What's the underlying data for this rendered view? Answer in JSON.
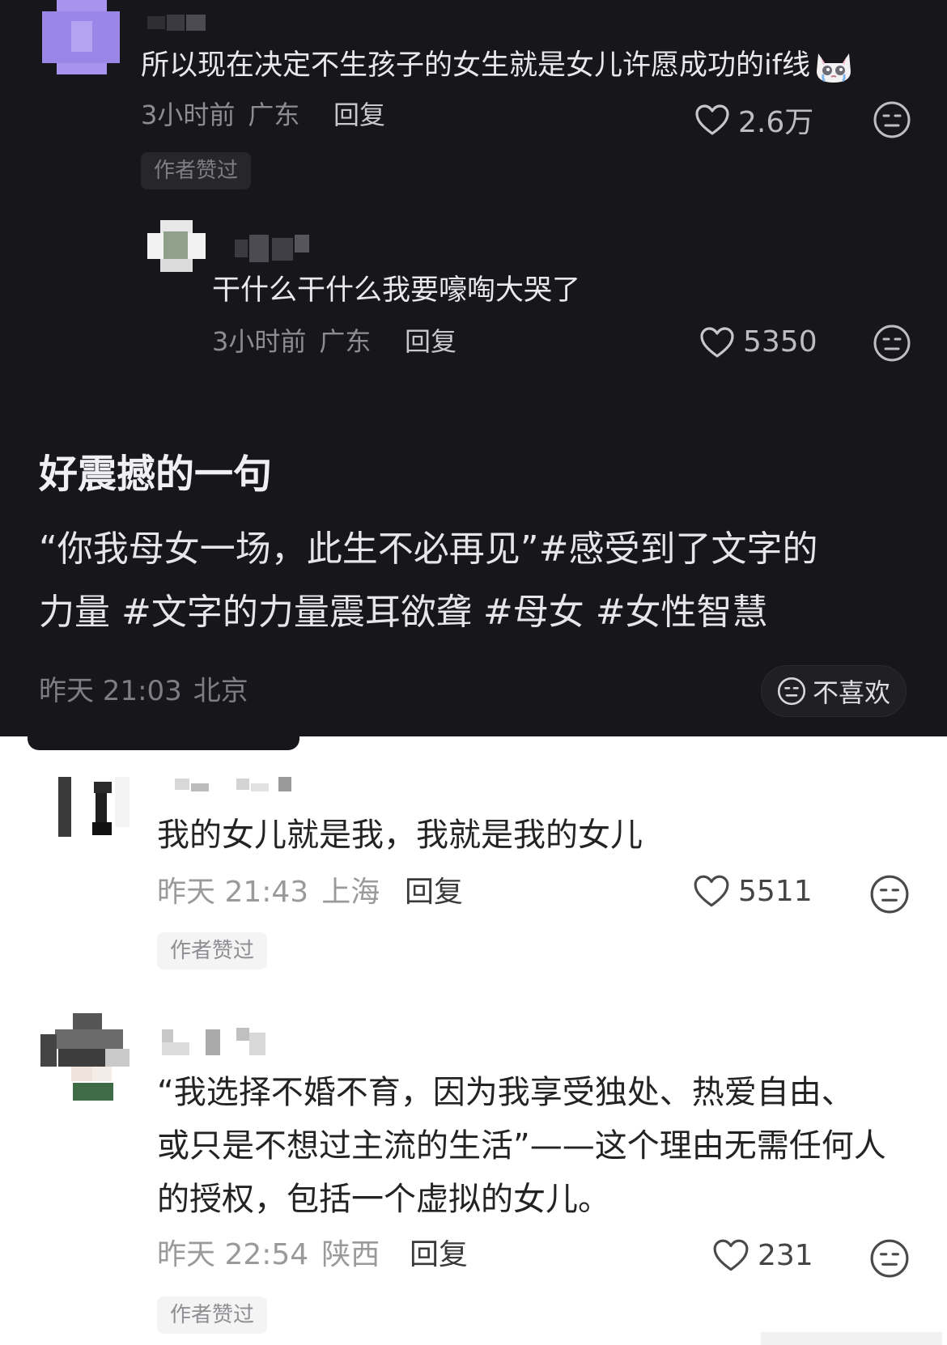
{
  "comment1": {
    "text": "所以现在决定不生孩子的女生就是女儿许愿成功的if线",
    "emoji": "crying-cat-emoji",
    "time": "3小时前",
    "location": "广东",
    "reply_label": "回复",
    "likes": "2.6万",
    "badge": "作者赞过"
  },
  "reply1": {
    "text": "干什么干什么我要嚎啕大哭了",
    "time": "3小时前",
    "location": "广东",
    "reply_label": "回复",
    "likes": "5350"
  },
  "post": {
    "title": "好震撼的一句",
    "body_line1": "“你我母女一场，此生不必再见”#感受到了文字的",
    "body_line2": "力量 #文字的力量震耳欲聋 #母女 #女性智慧",
    "time": "昨天 21:03",
    "location": "北京",
    "dislike_label": "不喜欢"
  },
  "comment2": {
    "text": "我的女儿就是我，我就是我的女儿",
    "time": "昨天 21:43",
    "location": "上海",
    "reply_label": "回复",
    "likes": "5511",
    "badge": "作者赞过"
  },
  "comment3": {
    "line1": "“我选择不婚不育，因为我享受独处、热爱自由、",
    "line2": "或只是不想过主流的生活”——这个理由无需任何人",
    "line3": "的授权，包括一个虚拟的女儿。",
    "time": "昨天 22:54",
    "location": "陕西",
    "reply_label": "回复",
    "likes": "231",
    "badge": "作者赞过"
  },
  "colors": {
    "dark_bg": "#17171b",
    "light_bg": "#ffffff",
    "avatar_purple": "#9a86e6"
  }
}
